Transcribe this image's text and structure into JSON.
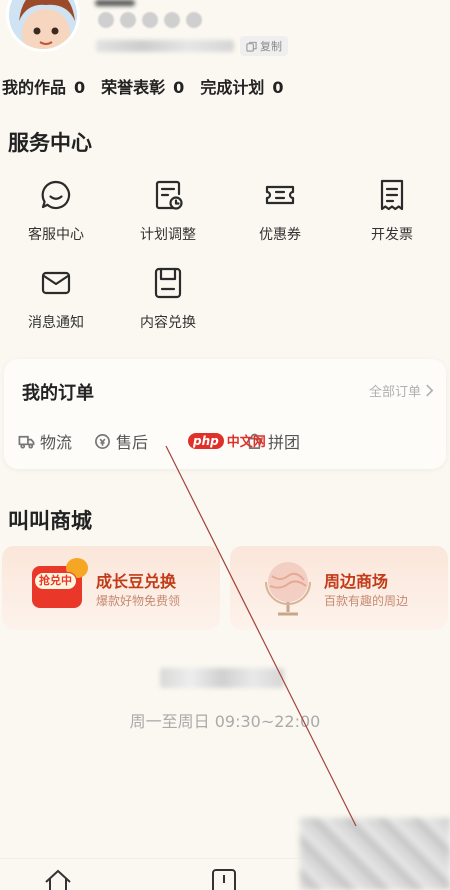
{
  "profile": {
    "copy_label": "复制",
    "stats": [
      {
        "label": "我的作品",
        "value": "0"
      },
      {
        "label": "荣誉表彰",
        "value": "0"
      },
      {
        "label": "完成计划",
        "value": "0"
      }
    ]
  },
  "service": {
    "title": "服务中心",
    "items": [
      {
        "label": "客服中心",
        "icon": "chat-bubble-icon"
      },
      {
        "label": "计划调整",
        "icon": "schedule-icon"
      },
      {
        "label": "优惠券",
        "icon": "coupon-icon"
      },
      {
        "label": "开发票",
        "icon": "invoice-icon"
      },
      {
        "label": "消息通知",
        "icon": "mail-icon"
      },
      {
        "label": "内容兑换",
        "icon": "exchange-icon"
      }
    ]
  },
  "orders": {
    "title": "我的订单",
    "all_label": "全部订单",
    "tabs": [
      {
        "label": "物流",
        "icon": "truck-icon"
      },
      {
        "label": "售后",
        "icon": "service-icon"
      },
      {
        "label": "评价",
        "icon": "comment-icon"
      },
      {
        "label": "拼团",
        "icon": "bag-icon"
      }
    ]
  },
  "watermark": {
    "php": "php",
    "site": "中文网"
  },
  "mall": {
    "title": "叫叫商城",
    "cards": [
      {
        "title": "成长豆兑换",
        "subtitle": "爆款好物免费领",
        "tag": "抢兑中"
      },
      {
        "title": "周边商场",
        "subtitle": "百款有趣的周边"
      }
    ]
  },
  "footer": {
    "hours": "周一至周日 09:30~22:00"
  },
  "colors": {
    "background": "#fbf8f1",
    "accent_red": "#e0302a",
    "mall_title": "#c23a18"
  }
}
